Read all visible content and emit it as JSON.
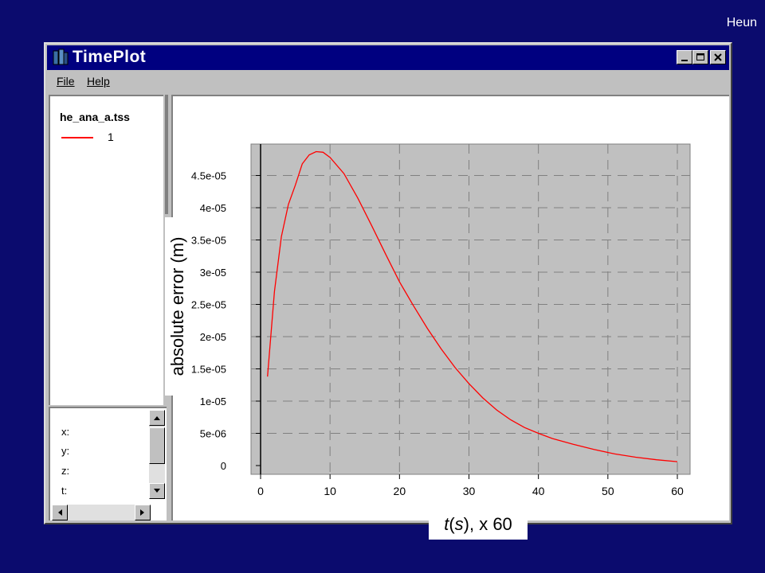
{
  "slide": {
    "label": "Heun"
  },
  "window": {
    "title": "TimePlot",
    "menu": [
      {
        "label": "File"
      },
      {
        "label": "Help"
      }
    ]
  },
  "legend": {
    "file": "he_ana_a.tss",
    "series_label": "1"
  },
  "coords": {
    "x": "x:",
    "y": "y:",
    "z": "z:",
    "t": "t:"
  },
  "axis_labels": {
    "y": "absolute error (m)",
    "x_var": "t",
    "x_paren_var": "s",
    "x_suffix": ", x 60"
  },
  "colors": {
    "series": "#ff0000",
    "plot_bg": "#c0c0c0",
    "title_bar": "#000080",
    "desktop": "#0b0b6e"
  },
  "chart_data": {
    "type": "line",
    "xlabel": "t(s), x 60",
    "ylabel": "absolute error (m)",
    "xlim": [
      0,
      60
    ],
    "ylim": [
      0,
      4.8e-05
    ],
    "grid": true,
    "x_ticks": [
      "0",
      "10",
      "20",
      "30",
      "40",
      "50",
      "60"
    ],
    "y_ticks": [
      "0",
      "5e-06",
      "1e-05",
      "1.5e-05",
      "2e-05",
      "2.5e-05",
      "3e-05",
      "3.5e-05",
      "4e-05",
      "4.5e-05"
    ],
    "series": [
      {
        "name": "1",
        "x": [
          1,
          2,
          3,
          4,
          5,
          6,
          7,
          8,
          9,
          10,
          12,
          14,
          16,
          18,
          20,
          22,
          24,
          26,
          28,
          30,
          32,
          34,
          36,
          38,
          40,
          42,
          45,
          48,
          51,
          54,
          57,
          60
        ],
        "y": [
          1.38e-05,
          2.7e-05,
          3.55e-05,
          4.05e-05,
          4.35e-05,
          4.68e-05,
          4.82e-05,
          4.87e-05,
          4.86e-05,
          4.78e-05,
          4.53e-05,
          4.15e-05,
          3.72e-05,
          3.28e-05,
          2.85e-05,
          2.48e-05,
          2.13e-05,
          1.81e-05,
          1.52e-05,
          1.27e-05,
          1.05e-05,
          8.6e-06,
          7.1e-06,
          5.9e-06,
          5e-06,
          4.2e-06,
          3.3e-06,
          2.5e-06,
          1.8e-06,
          1.3e-06,
          9e-07,
          6e-07
        ]
      }
    ]
  }
}
